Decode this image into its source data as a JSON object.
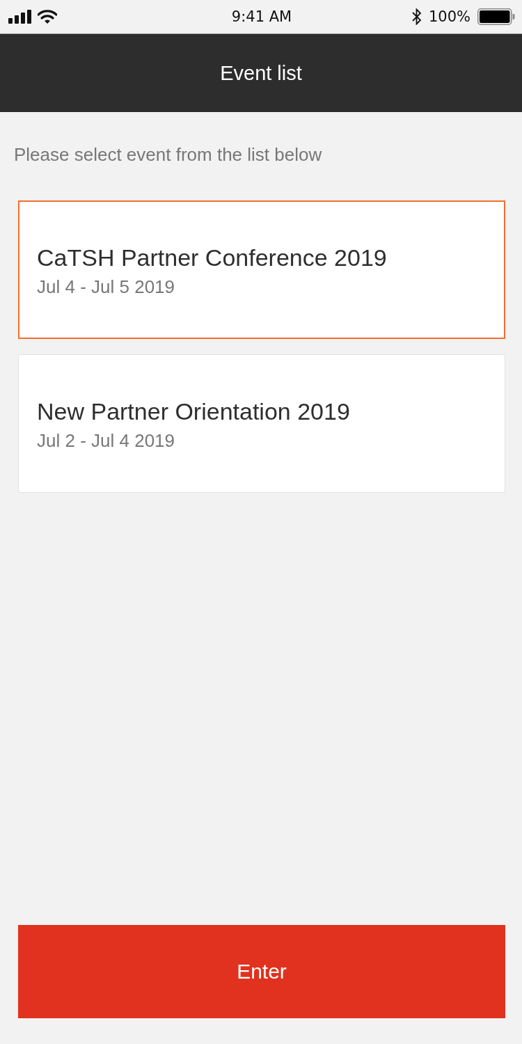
{
  "status_bar": {
    "time": "9:41 AM",
    "battery": "100%"
  },
  "header": {
    "title": "Event list"
  },
  "instructions": "Please select event from the list below",
  "events": [
    {
      "title": "CaTSH Partner Conference 2019",
      "dates": "Jul 4 - Jul 5 2019",
      "selected": true
    },
    {
      "title": "New Partner Orientation 2019",
      "dates": "Jul 2 - Jul 4 2019",
      "selected": false
    }
  ],
  "enter_button": {
    "label": "Enter"
  }
}
